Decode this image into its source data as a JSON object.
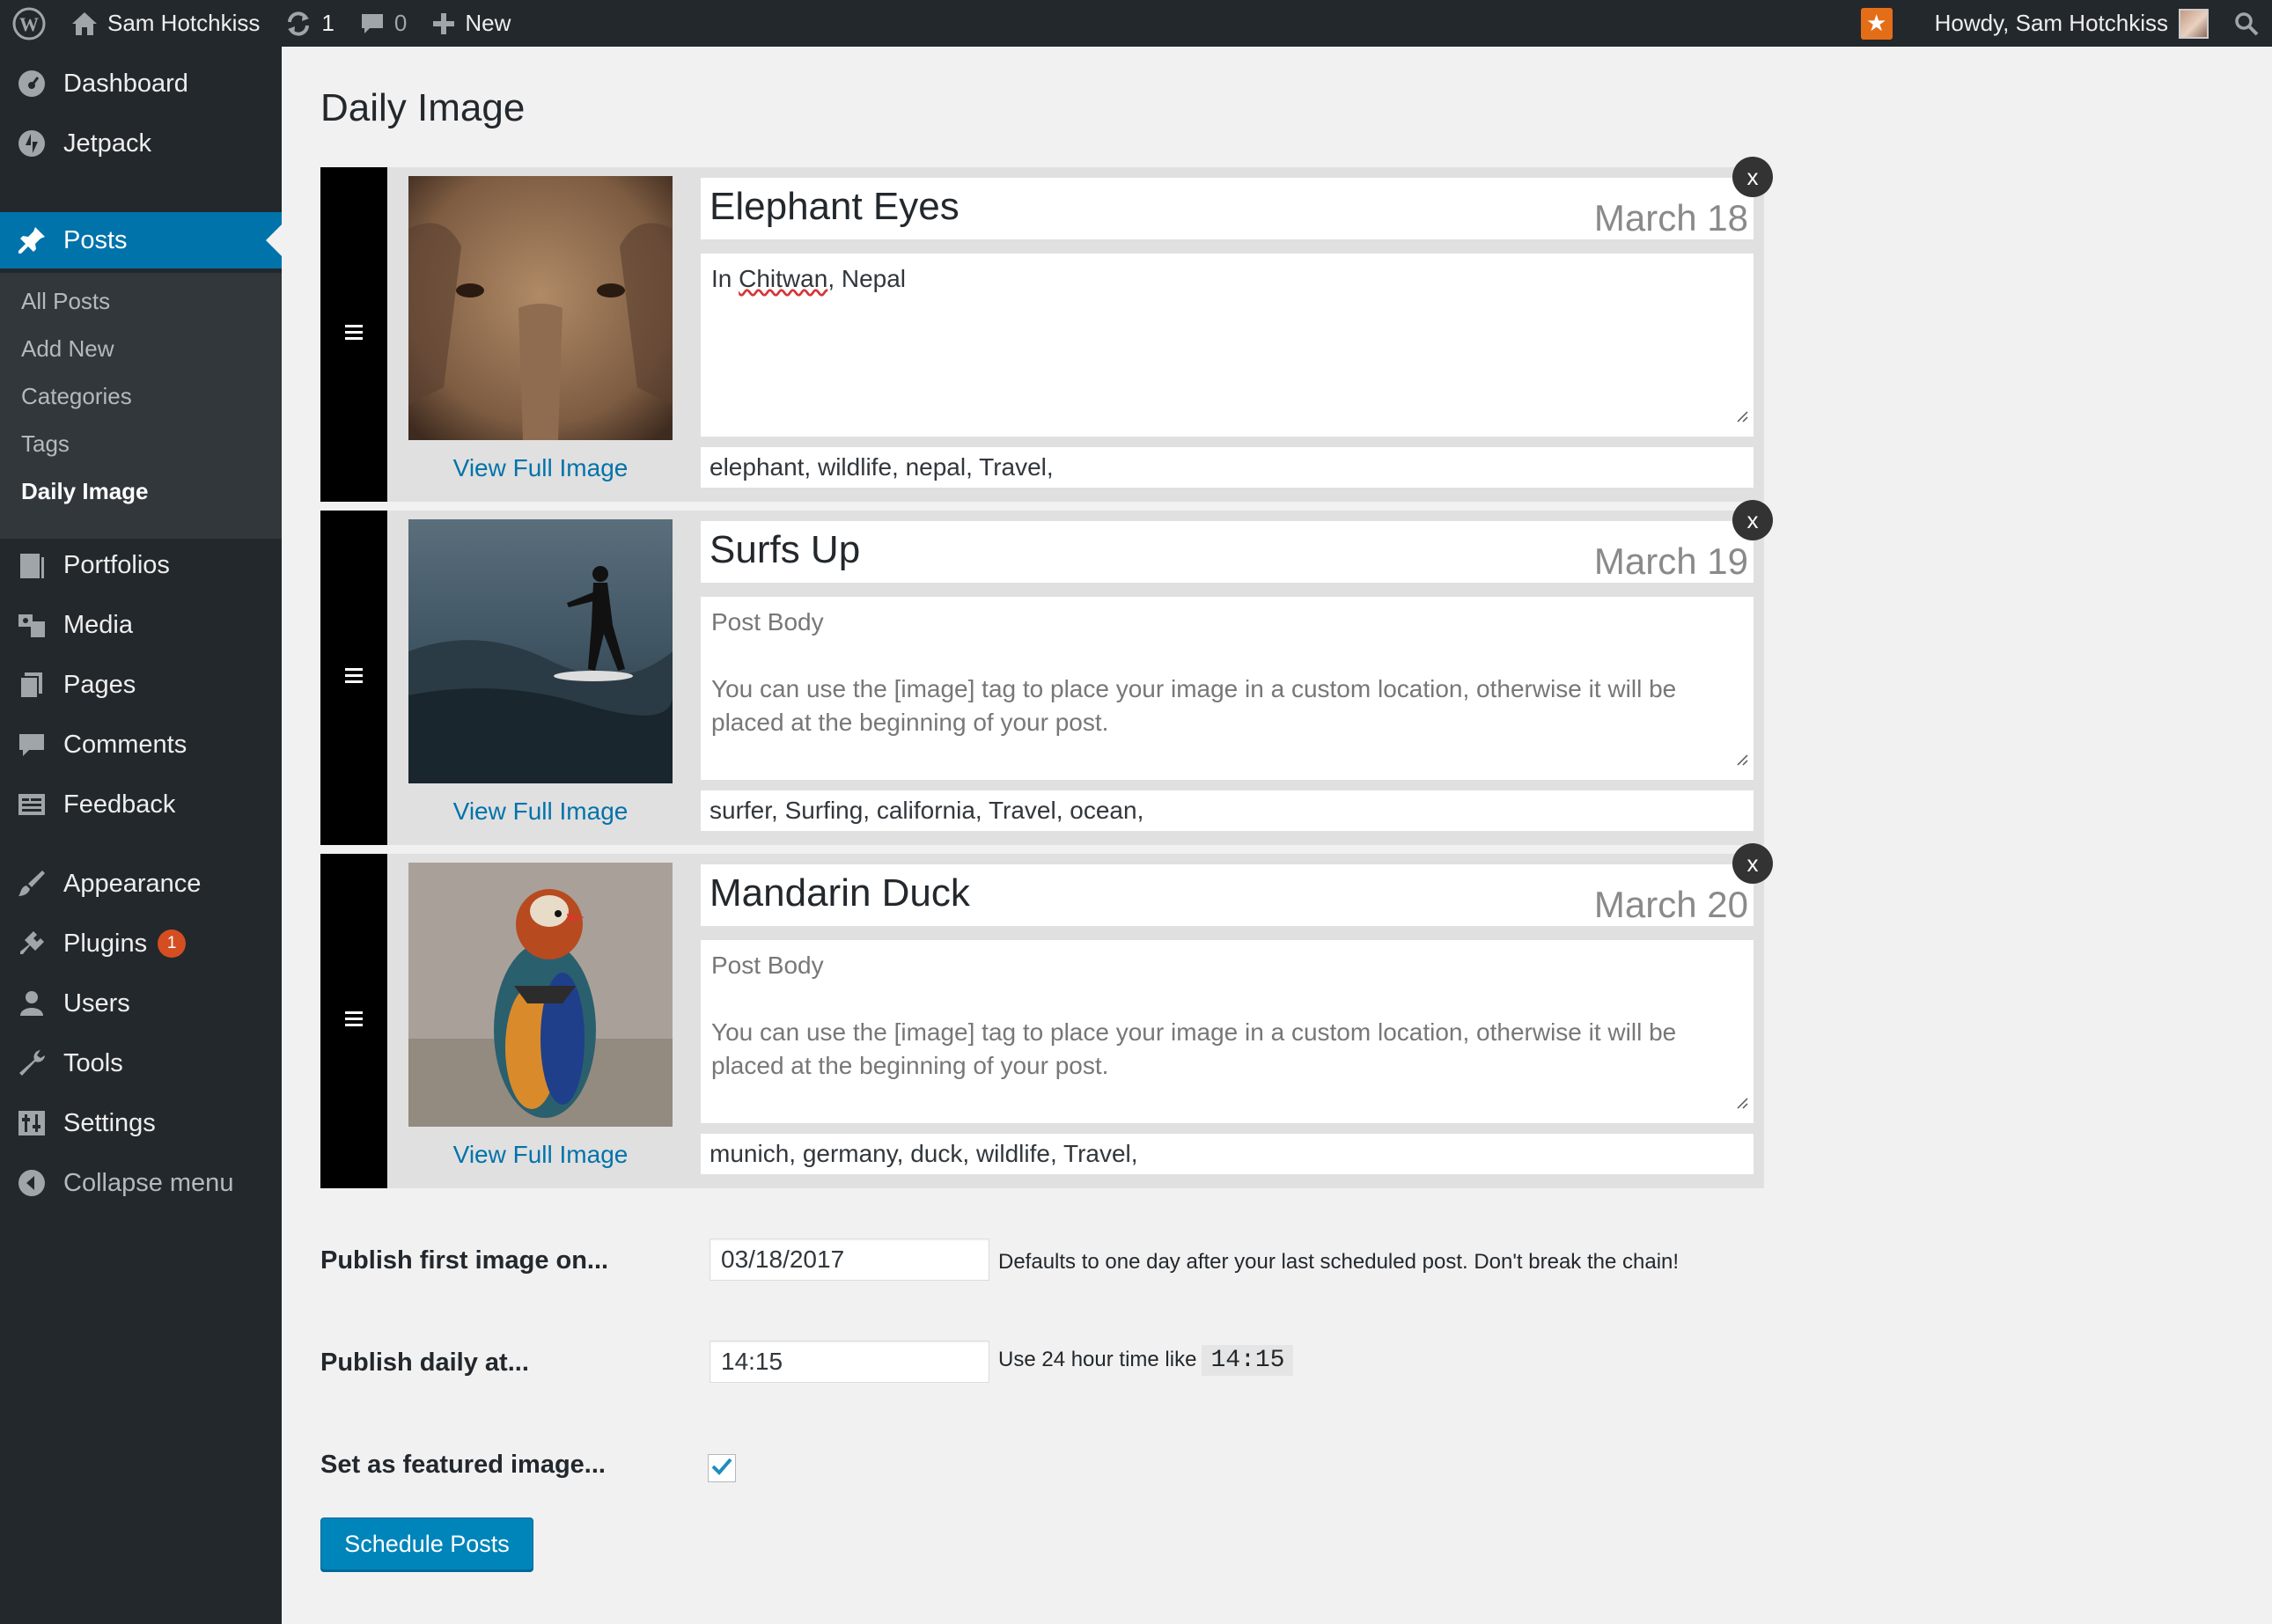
{
  "adminbar": {
    "site_name": "Sam Hotchkiss",
    "updates_count": "1",
    "comments_count": "0",
    "new_label": "New",
    "greeting": "Howdy, Sam Hotchkiss"
  },
  "sidebar": {
    "dashboard": "Dashboard",
    "jetpack": "Jetpack",
    "posts": "Posts",
    "sub": {
      "all_posts": "All Posts",
      "add_new": "Add New",
      "categories": "Categories",
      "tags": "Tags",
      "daily_image": "Daily Image"
    },
    "portfolios": "Portfolios",
    "media": "Media",
    "pages": "Pages",
    "comments": "Comments",
    "feedback": "Feedback",
    "appearance": "Appearance",
    "plugins": "Plugins",
    "plugins_badge": "1",
    "users": "Users",
    "tools": "Tools",
    "settings": "Settings",
    "collapse": "Collapse menu"
  },
  "page": {
    "title": "Daily Image"
  },
  "cards": [
    {
      "title": "Elephant Eyes",
      "date": "March 18",
      "body_prefix": "In ",
      "body_misspelled": "Chitwan",
      "body_suffix": ", Nepal",
      "tags": "elephant, wildlife, nepal, Travel,",
      "view_label": "View Full Image",
      "close_label": "x"
    },
    {
      "title": "Surfs Up",
      "date": "March 19",
      "body_placeholder_line1": "Post Body",
      "body_placeholder_line2": "You can use the [image] tag to place your image in a custom location, otherwise it will be placed at the beginning of your post.",
      "tags": "surfer, Surfing, california, Travel, ocean,",
      "view_label": "View Full Image",
      "close_label": "x"
    },
    {
      "title": "Mandarin Duck",
      "date": "March 20",
      "body_placeholder_line1": "Post Body",
      "body_placeholder_line2": "You can use the [image] tag to place your image in a custom location, otherwise it will be placed at the beginning of your post.",
      "tags": "munich, germany, duck, wildlife, Travel,",
      "view_label": "View Full Image",
      "close_label": "x"
    }
  ],
  "form": {
    "publish_first_label": "Publish first image on...",
    "publish_first_value": "03/18/2017",
    "publish_first_desc": "Defaults to one day after your last scheduled post. Don't break the chain!",
    "publish_daily_label": "Publish daily at...",
    "publish_daily_value": "14:15",
    "publish_daily_desc": "Use 24 hour time like",
    "publish_daily_example": "14:15",
    "featured_label": "Set as featured image...",
    "featured_checked": true,
    "submit_label": "Schedule Posts"
  },
  "colors": {
    "sidebar_bg": "#23282d",
    "accent": "#0073aa",
    "button": "#0085ba",
    "badge": "#d54e21",
    "star_badge": "#e46e18"
  }
}
